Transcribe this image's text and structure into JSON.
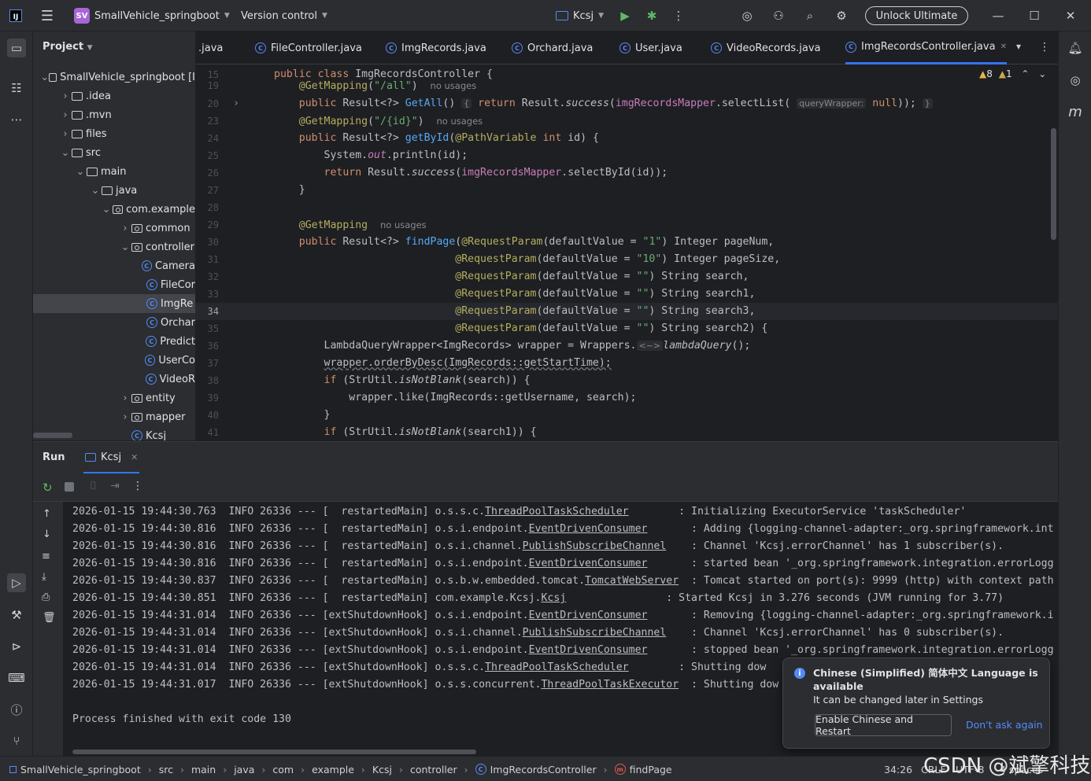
{
  "titlebar": {
    "project_badge": "SV",
    "project_name": "SmallVehicle_springboot",
    "vcs": "Version control",
    "run_config": "Kcsj",
    "unlock": "Unlock Ultimate"
  },
  "project_panel": {
    "title": "Project",
    "tree": [
      {
        "label": "SmallVehicle_springboot [I",
        "type": "folder",
        "depth": 0,
        "open": true
      },
      {
        "label": ".idea",
        "type": "folder",
        "depth": 1,
        "open": false
      },
      {
        "label": ".mvn",
        "type": "folder",
        "depth": 1,
        "open": false
      },
      {
        "label": "files",
        "type": "folder",
        "depth": 1,
        "open": false
      },
      {
        "label": "src",
        "type": "folder",
        "depth": 1,
        "open": true
      },
      {
        "label": "main",
        "type": "folder",
        "depth": 2,
        "open": true
      },
      {
        "label": "java",
        "type": "folder",
        "depth": 3,
        "open": true
      },
      {
        "label": "com.example",
        "type": "pkg",
        "depth": 4,
        "open": true
      },
      {
        "label": "common",
        "type": "pkg",
        "depth": 5,
        "open": false
      },
      {
        "label": "controller",
        "type": "pkg",
        "depth": 5,
        "open": true
      },
      {
        "label": "Camera",
        "type": "class",
        "depth": 6
      },
      {
        "label": "FileCor",
        "type": "class",
        "depth": 6
      },
      {
        "label": "ImgRe",
        "type": "class",
        "depth": 6,
        "selected": true
      },
      {
        "label": "Orchar",
        "type": "class",
        "depth": 6
      },
      {
        "label": "Predict",
        "type": "class",
        "depth": 6
      },
      {
        "label": "UserCo",
        "type": "class",
        "depth": 6
      },
      {
        "label": "VideoR",
        "type": "class",
        "depth": 6
      },
      {
        "label": "entity",
        "type": "pkg",
        "depth": 5,
        "open": false
      },
      {
        "label": "mapper",
        "type": "pkg",
        "depth": 5,
        "open": false
      },
      {
        "label": "Kcsj",
        "type": "class",
        "depth": 5
      }
    ]
  },
  "editor": {
    "tabs": [
      {
        "label": ".java",
        "icon": false
      },
      {
        "label": "FileController.java",
        "icon": true
      },
      {
        "label": "ImgRecords.java",
        "icon": true
      },
      {
        "label": "Orchard.java",
        "icon": true
      },
      {
        "label": "User.java",
        "icon": true
      },
      {
        "label": "VideoRecords.java",
        "icon": true
      },
      {
        "label": "ImgRecordsController.java",
        "icon": true,
        "active": true
      }
    ],
    "warnings": "8",
    "weak_warnings": "1",
    "lines": [
      {
        "n": "15",
        "html": "<span class=\"kw\">public class </span>ImgRecordsController {"
      },
      {
        "n": "19",
        "html": "    <span class=\"ann\">@GetMapping</span>(<span class=\"str\">\"/all\"</span>)  <span class=\"hint\">no usages</span>"
      },
      {
        "n": "20",
        "html": "    <span class=\"kw\">public </span>Result&lt;?&gt; <span class=\"fn\">GetAll</span>() <span class=\"inlay\">{</span> <span class=\"kw\">return </span>Result.<span class=\"it\">success</span>(<span class=\"fld\">imgRecordsMapper</span>.selectList( <span class=\"inlay\">queryWrapper:</span> <span class=\"kw\">null</span>)); <span class=\"inlay\">}</span>"
      },
      {
        "n": "23",
        "html": "    <span class=\"ann\">@GetMapping</span>(<span class=\"str\">\"/{id}\"</span>)  <span class=\"hint\">no usages</span>"
      },
      {
        "n": "24",
        "html": "    <span class=\"kw\">public </span>Result&lt;?&gt; <span class=\"fn\">getById</span>(<span class=\"ann\">@PathVariable </span><span class=\"kw\">int </span>id) {"
      },
      {
        "n": "25",
        "html": "        System.<span class=\"fld it\">out</span>.println(id);"
      },
      {
        "n": "26",
        "html": "        <span class=\"kw\">return </span>Result.<span class=\"it\">success</span>(<span class=\"fld\">imgRecordsMapper</span>.selectById(id));"
      },
      {
        "n": "27",
        "html": "    }"
      },
      {
        "n": "28",
        "html": ""
      },
      {
        "n": "29",
        "html": "    <span class=\"ann\">@GetMapping</span>  <span class=\"hint\">no usages</span>"
      },
      {
        "n": "30",
        "html": "    <span class=\"kw\">public </span>Result&lt;?&gt; <span class=\"fn\">findPage</span>(<span class=\"ann\">@RequestParam</span>(defaultValue = <span class=\"str\">\"1\"</span>) Integer pageNum,"
      },
      {
        "n": "31",
        "html": "                             <span class=\"ann\">@RequestParam</span>(defaultValue = <span class=\"str\">\"10\"</span>) Integer pageSize,"
      },
      {
        "n": "32",
        "html": "                             <span class=\"ann\">@RequestParam</span>(defaultValue = <span class=\"str\">\"\"</span>) String search,"
      },
      {
        "n": "33",
        "html": "                             <span class=\"ann\">@RequestParam</span>(defaultValue = <span class=\"str\">\"\"</span>) String search1,"
      },
      {
        "n": "34",
        "html": "                             <span class=\"ann\">@RequestParam</span>(defaultValue = <span class=\"str\">\"\"</span>) String search3,",
        "current": true
      },
      {
        "n": "35",
        "html": "                             <span class=\"ann\">@RequestParam</span>(defaultValue = <span class=\"str\">\"\"</span>) String search2) {"
      },
      {
        "n": "36",
        "html": "        LambdaQueryWrapper&lt;ImgRecords&gt; wrapper = Wrappers.<span class=\"inlay\">&lt;~&gt;</span><span class=\"it\">lambdaQuery</span>();"
      },
      {
        "n": "37",
        "html": "        <span style=\"text-decoration: underline wavy #6f737a;\">wrapper.orderByDesc(ImgRecords::getStartTime);</span>"
      },
      {
        "n": "38",
        "html": "        <span class=\"kw\">if </span>(StrUtil.<span class=\"it\">isNotBlank</span>(search)) {"
      },
      {
        "n": "39",
        "html": "            wrapper.like(ImgRecords::getUsername, search);"
      },
      {
        "n": "40",
        "html": "        }"
      },
      {
        "n": "41",
        "html": "        <span class=\"kw\">if </span>(StrUtil.<span class=\"it\">isNotBlank</span>(search1)) {"
      }
    ]
  },
  "run_panel": {
    "title": "Run",
    "tab": "Kcsj",
    "logs": [
      {
        "prefix": "2026-01-15 19:44:30.763  INFO 26336 --- [  restartedMain] o.s.s.c.",
        "cls": "ThreadPoolTaskScheduler",
        "pad": "       ",
        "msg": " : Initializing ExecutorService 'taskScheduler'"
      },
      {
        "prefix": "2026-01-15 19:44:30.816  INFO 26336 --- [  restartedMain] o.s.i.endpoint.",
        "cls": "EventDrivenConsumer",
        "pad": "      ",
        "msg": " : Adding {logging-channel-adapter:_org.springframework.int"
      },
      {
        "prefix": "2026-01-15 19:44:30.816  INFO 26336 --- [  restartedMain] o.s.i.channel.",
        "cls": "PublishSubscribeChannel",
        "pad": "   ",
        "msg": " : Channel 'Kcsj.errorChannel' has 1 subscriber(s)."
      },
      {
        "prefix": "2026-01-15 19:44:30.816  INFO 26336 --- [  restartedMain] o.s.i.endpoint.",
        "cls": "EventDrivenConsumer",
        "pad": "      ",
        "msg": " : started bean '_org.springframework.integration.errorLogg"
      },
      {
        "prefix": "2026-01-15 19:44:30.837  INFO 26336 --- [  restartedMain] o.s.b.w.embedded.tomcat.",
        "cls": "TomcatWebServer",
        "pad": " ",
        "msg": " : Tomcat started on port(s): 9999 (http) with context path"
      },
      {
        "prefix": "2026-01-15 19:44:30.851  INFO 26336 --- [  restartedMain] com.example.Kcsj.",
        "cls": "Kcsj",
        "pad": "               ",
        "msg": " : Started Kcsj in 3.276 seconds (JVM running for 3.77)"
      },
      {
        "prefix": "2026-01-15 19:44:31.014  INFO 26336 --- [extShutdownHook] o.s.i.endpoint.",
        "cls": "EventDrivenConsumer",
        "pad": "      ",
        "msg": " : Removing {logging-channel-adapter:_org.springframework.i"
      },
      {
        "prefix": "2026-01-15 19:44:31.014  INFO 26336 --- [extShutdownHook] o.s.i.channel.",
        "cls": "PublishSubscribeChannel",
        "pad": "   ",
        "msg": " : Channel 'Kcsj.errorChannel' has 0 subscriber(s)."
      },
      {
        "prefix": "2026-01-15 19:44:31.014  INFO 26336 --- [extShutdownHook] o.s.i.endpoint.",
        "cls": "EventDrivenConsumer",
        "pad": "      ",
        "msg": " : stopped bean '_org.springframework.integration.errorLogg"
      },
      {
        "prefix": "2026-01-15 19:44:31.014  INFO 26336 --- [extShutdownHook] o.s.s.c.",
        "cls": "ThreadPoolTaskScheduler",
        "pad": "       ",
        "msg": " : Shutting dow"
      },
      {
        "prefix": "2026-01-15 19:44:31.017  INFO 26336 --- [extShutdownHook] o.s.s.concurrent.",
        "cls": "ThreadPoolTaskExecutor",
        "pad": " ",
        "msg": " : Shutting dow"
      }
    ],
    "exit_message": "Process finished with exit code 130"
  },
  "notification": {
    "title": "Chinese (Simplified) 简体中文 Language is available",
    "body": "It can be changed later in Settings",
    "primary": "Enable Chinese and Restart",
    "secondary": "Don't ask again"
  },
  "statusbar": {
    "breadcrumbs": [
      "SmallVehicle_springboot",
      "src",
      "main",
      "java",
      "com",
      "example",
      "Kcsj",
      "controller",
      "ImgRecordsController",
      "findPage"
    ],
    "position": "34:26",
    "line_sep": "CRLF",
    "encoding": "UTF-8",
    "indent": "4 spaces"
  },
  "watermark": "CSDN @斌擎科技"
}
